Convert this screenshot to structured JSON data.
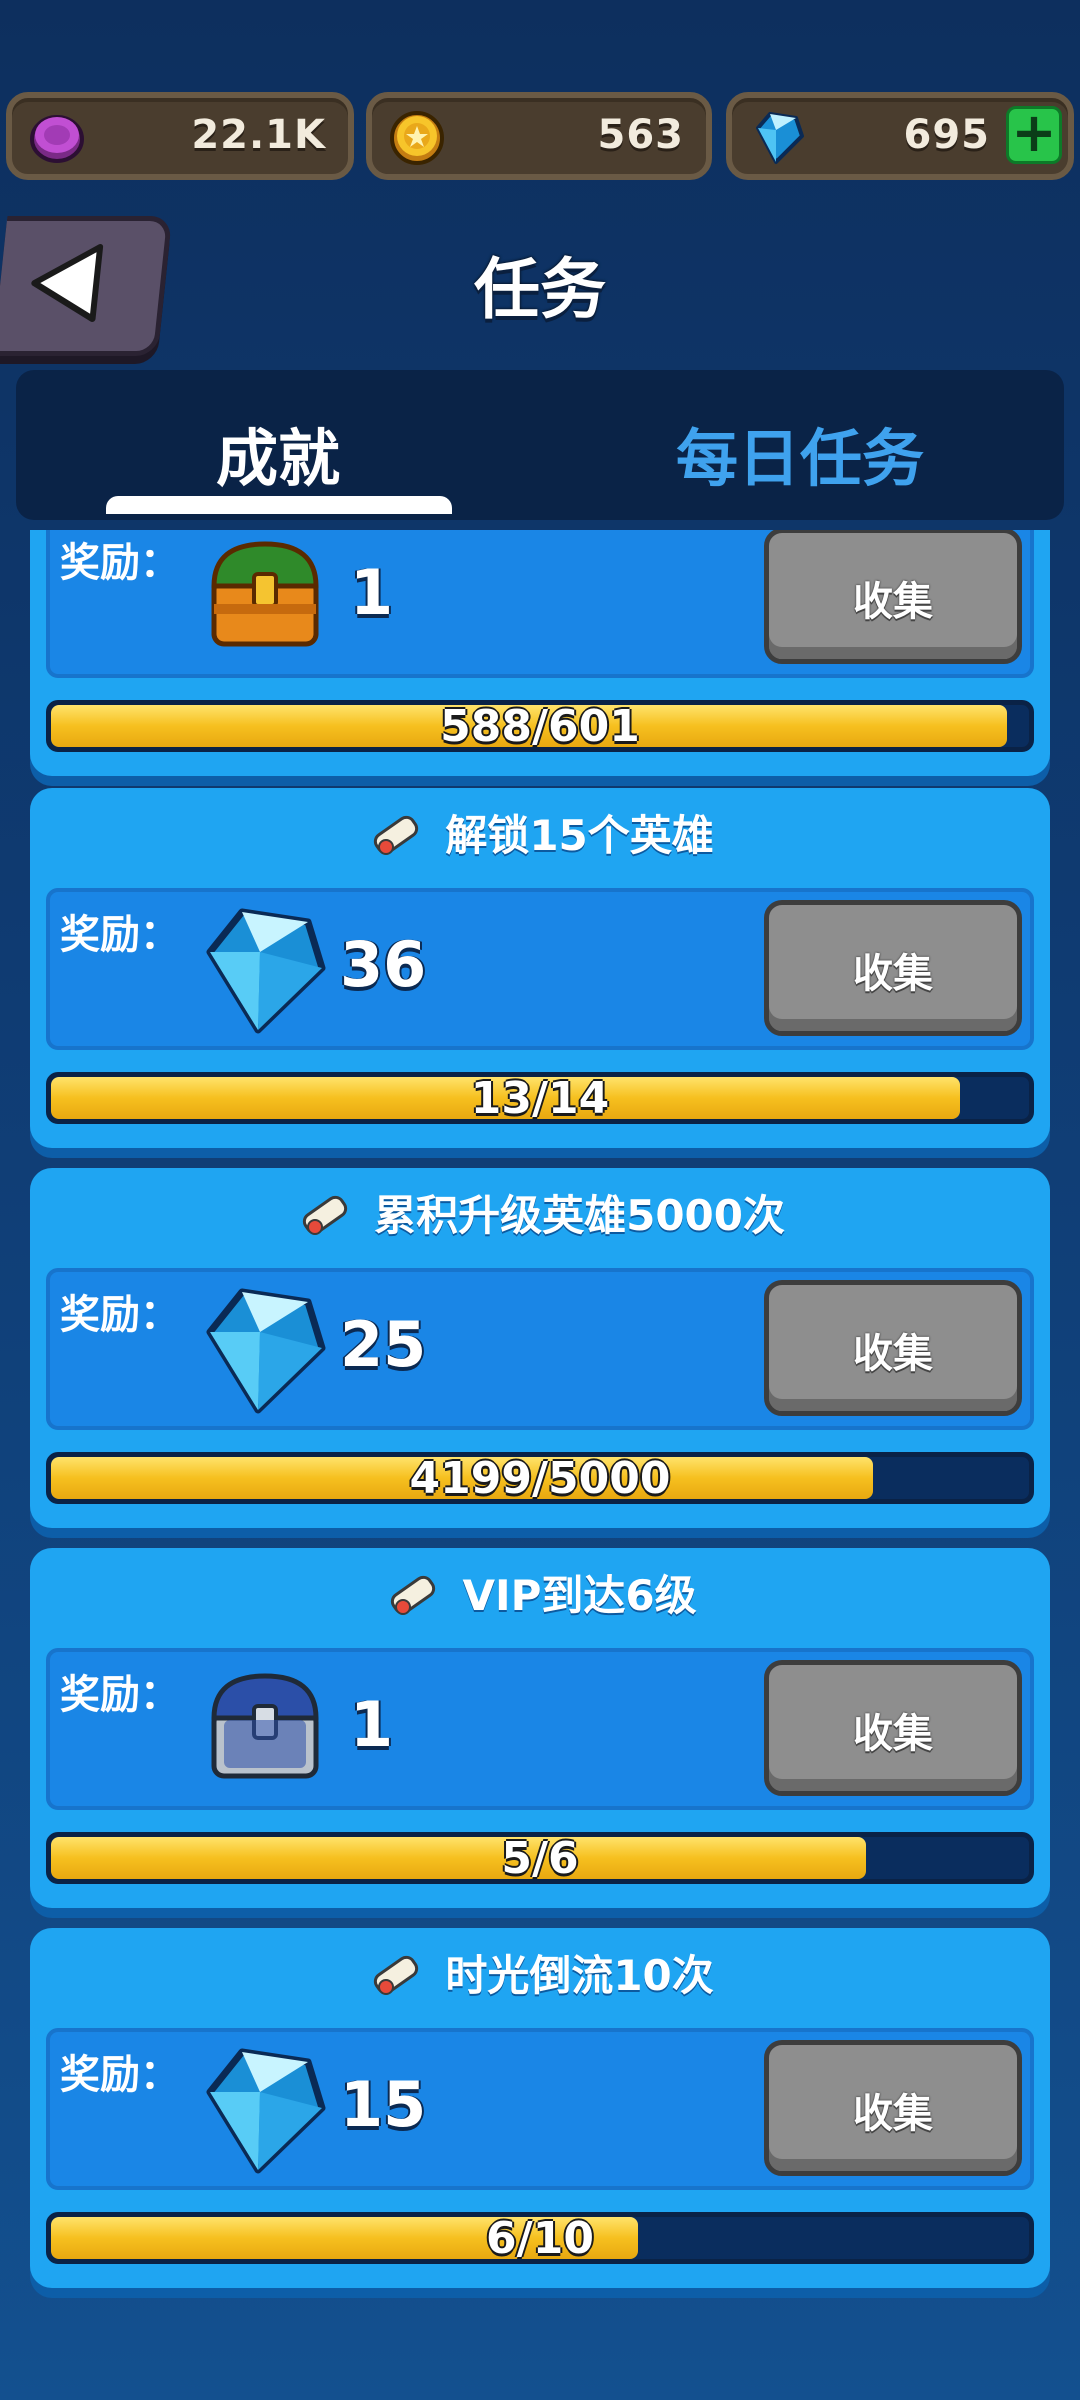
{
  "resources": {
    "elixir": {
      "value": "22.1K",
      "icon": "purple-coin-icon"
    },
    "gold": {
      "value": "563",
      "icon": "gold-coin-icon"
    },
    "gems": {
      "value": "695",
      "icon": "diamond-icon",
      "add_label": "+"
    }
  },
  "header": {
    "title": "任务",
    "back_icon": "back-arrow-icon"
  },
  "tabs": [
    {
      "label": "成就",
      "active": true
    },
    {
      "label": "每日任务",
      "active": false
    }
  ],
  "quests": [
    {
      "title": "",
      "reward_label": "奖励：",
      "reward_icon": "green-chest-icon",
      "reward_qty": "1",
      "collect_label": "收集",
      "progress_text": "588/601",
      "progress": 0.978
    },
    {
      "title": "解锁15个英雄",
      "reward_label": "奖励：",
      "reward_icon": "diamond-icon",
      "reward_qty": "36",
      "collect_label": "收集",
      "progress_text": "13/14",
      "progress": 0.929
    },
    {
      "title": "累积升级英雄5000次",
      "reward_label": "奖励：",
      "reward_icon": "diamond-icon",
      "reward_qty": "25",
      "collect_label": "收集",
      "progress_text": "4199/5000",
      "progress": 0.84
    },
    {
      "title": "VIP到达6级",
      "reward_label": "奖励：",
      "reward_icon": "blue-chest-icon",
      "reward_qty": "1",
      "collect_label": "收集",
      "progress_text": "5/6",
      "progress": 0.833
    },
    {
      "title": "时光倒流10次",
      "reward_label": "奖励：",
      "reward_icon": "diamond-icon",
      "reward_qty": "15",
      "collect_label": "收集",
      "progress_text": "6/10",
      "progress": 0.6
    }
  ]
}
